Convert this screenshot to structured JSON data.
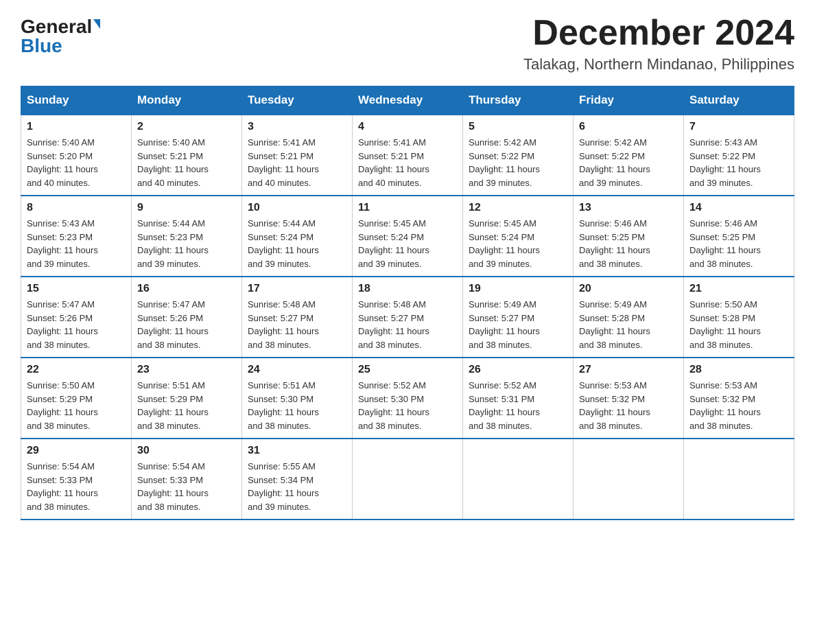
{
  "header": {
    "logo": {
      "general": "General",
      "blue": "Blue"
    },
    "title": "December 2024",
    "location": "Talakag, Northern Mindanao, Philippines"
  },
  "weekdays": [
    "Sunday",
    "Monday",
    "Tuesday",
    "Wednesday",
    "Thursday",
    "Friday",
    "Saturday"
  ],
  "weeks": [
    [
      {
        "day": "1",
        "sunrise": "5:40 AM",
        "sunset": "5:20 PM",
        "daylight": "11 hours and 40 minutes."
      },
      {
        "day": "2",
        "sunrise": "5:40 AM",
        "sunset": "5:21 PM",
        "daylight": "11 hours and 40 minutes."
      },
      {
        "day": "3",
        "sunrise": "5:41 AM",
        "sunset": "5:21 PM",
        "daylight": "11 hours and 40 minutes."
      },
      {
        "day": "4",
        "sunrise": "5:41 AM",
        "sunset": "5:21 PM",
        "daylight": "11 hours and 40 minutes."
      },
      {
        "day": "5",
        "sunrise": "5:42 AM",
        "sunset": "5:22 PM",
        "daylight": "11 hours and 39 minutes."
      },
      {
        "day": "6",
        "sunrise": "5:42 AM",
        "sunset": "5:22 PM",
        "daylight": "11 hours and 39 minutes."
      },
      {
        "day": "7",
        "sunrise": "5:43 AM",
        "sunset": "5:22 PM",
        "daylight": "11 hours and 39 minutes."
      }
    ],
    [
      {
        "day": "8",
        "sunrise": "5:43 AM",
        "sunset": "5:23 PM",
        "daylight": "11 hours and 39 minutes."
      },
      {
        "day": "9",
        "sunrise": "5:44 AM",
        "sunset": "5:23 PM",
        "daylight": "11 hours and 39 minutes."
      },
      {
        "day": "10",
        "sunrise": "5:44 AM",
        "sunset": "5:24 PM",
        "daylight": "11 hours and 39 minutes."
      },
      {
        "day": "11",
        "sunrise": "5:45 AM",
        "sunset": "5:24 PM",
        "daylight": "11 hours and 39 minutes."
      },
      {
        "day": "12",
        "sunrise": "5:45 AM",
        "sunset": "5:24 PM",
        "daylight": "11 hours and 39 minutes."
      },
      {
        "day": "13",
        "sunrise": "5:46 AM",
        "sunset": "5:25 PM",
        "daylight": "11 hours and 38 minutes."
      },
      {
        "day": "14",
        "sunrise": "5:46 AM",
        "sunset": "5:25 PM",
        "daylight": "11 hours and 38 minutes."
      }
    ],
    [
      {
        "day": "15",
        "sunrise": "5:47 AM",
        "sunset": "5:26 PM",
        "daylight": "11 hours and 38 minutes."
      },
      {
        "day": "16",
        "sunrise": "5:47 AM",
        "sunset": "5:26 PM",
        "daylight": "11 hours and 38 minutes."
      },
      {
        "day": "17",
        "sunrise": "5:48 AM",
        "sunset": "5:27 PM",
        "daylight": "11 hours and 38 minutes."
      },
      {
        "day": "18",
        "sunrise": "5:48 AM",
        "sunset": "5:27 PM",
        "daylight": "11 hours and 38 minutes."
      },
      {
        "day": "19",
        "sunrise": "5:49 AM",
        "sunset": "5:27 PM",
        "daylight": "11 hours and 38 minutes."
      },
      {
        "day": "20",
        "sunrise": "5:49 AM",
        "sunset": "5:28 PM",
        "daylight": "11 hours and 38 minutes."
      },
      {
        "day": "21",
        "sunrise": "5:50 AM",
        "sunset": "5:28 PM",
        "daylight": "11 hours and 38 minutes."
      }
    ],
    [
      {
        "day": "22",
        "sunrise": "5:50 AM",
        "sunset": "5:29 PM",
        "daylight": "11 hours and 38 minutes."
      },
      {
        "day": "23",
        "sunrise": "5:51 AM",
        "sunset": "5:29 PM",
        "daylight": "11 hours and 38 minutes."
      },
      {
        "day": "24",
        "sunrise": "5:51 AM",
        "sunset": "5:30 PM",
        "daylight": "11 hours and 38 minutes."
      },
      {
        "day": "25",
        "sunrise": "5:52 AM",
        "sunset": "5:30 PM",
        "daylight": "11 hours and 38 minutes."
      },
      {
        "day": "26",
        "sunrise": "5:52 AM",
        "sunset": "5:31 PM",
        "daylight": "11 hours and 38 minutes."
      },
      {
        "day": "27",
        "sunrise": "5:53 AM",
        "sunset": "5:32 PM",
        "daylight": "11 hours and 38 minutes."
      },
      {
        "day": "28",
        "sunrise": "5:53 AM",
        "sunset": "5:32 PM",
        "daylight": "11 hours and 38 minutes."
      }
    ],
    [
      {
        "day": "29",
        "sunrise": "5:54 AM",
        "sunset": "5:33 PM",
        "daylight": "11 hours and 38 minutes."
      },
      {
        "day": "30",
        "sunrise": "5:54 AM",
        "sunset": "5:33 PM",
        "daylight": "11 hours and 38 minutes."
      },
      {
        "day": "31",
        "sunrise": "5:55 AM",
        "sunset": "5:34 PM",
        "daylight": "11 hours and 39 minutes."
      },
      null,
      null,
      null,
      null
    ]
  ],
  "labels": {
    "sunrise": "Sunrise:",
    "sunset": "Sunset:",
    "daylight": "Daylight:"
  }
}
